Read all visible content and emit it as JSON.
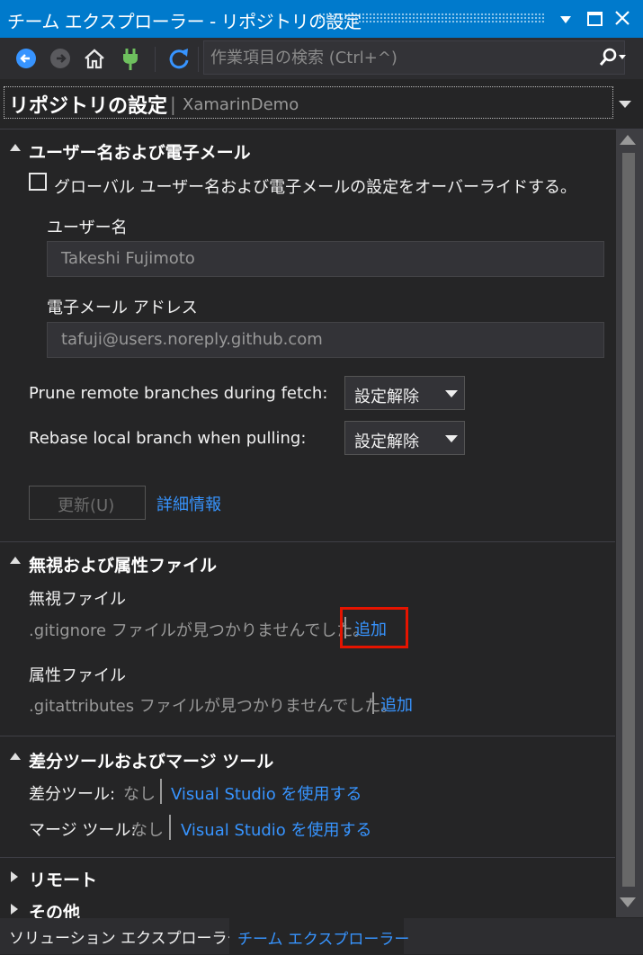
{
  "window": {
    "title": "チーム エクスプローラー - リポジトリの設定",
    "minimize_icon": "dropdown-arrow",
    "maximize_icon": "square",
    "close_icon": "x"
  },
  "toolbar": {
    "search_placeholder": "作業項目の検索 (Ctrl+^)",
    "icons": [
      "back-icon",
      "forward-icon",
      "home-icon",
      "plug-icon",
      "refresh-icon",
      "search-icon"
    ]
  },
  "header": {
    "title": "リポジトリの設定",
    "subtitle": "XamarinDemo"
  },
  "user_section": {
    "title": "ユーザー名および電子メール",
    "override_checkbox_label": "グローバル ユーザー名および電子メールの設定をオーバーライドする。",
    "override_checked": false,
    "username_label": "ユーザー名",
    "username_value": "Takeshi Fujimoto",
    "email_label": "電子メール アドレス",
    "email_value": "tafuji@users.noreply.github.com",
    "prune_label": "Prune remote branches during fetch:",
    "prune_value": "設定解除",
    "rebase_label": "Rebase local branch when pulling:",
    "rebase_value": "設定解除",
    "update_button": "更新(U)",
    "more_info_link": "詳細情報"
  },
  "ignore_section": {
    "title": "無視および属性ファイル",
    "ignore_label": "無視ファイル",
    "ignore_status": ".gitignore ファイルが見つかりませんでした。",
    "ignore_add": "追加",
    "attr_label": "属性ファイル",
    "attr_status": ".gitattributes ファイルが見つかりませんでした。",
    "attr_add": "追加"
  },
  "diff_section": {
    "title": "差分ツールおよびマージ ツール",
    "diff_label": "差分ツール:",
    "diff_value": "なし",
    "diff_link": "Visual Studio を使用する",
    "merge_label": "マージ ツール:",
    "merge_value": "なし",
    "merge_link": "Visual Studio を使用する"
  },
  "collapsed_sections": {
    "remote": "リモート",
    "other": "その他"
  },
  "tabs": [
    {
      "label": "ソリューション エクスプローラー",
      "active": false
    },
    {
      "label": "チーム エクスプローラー",
      "active": true
    }
  ],
  "colors": {
    "accent": "#007acc",
    "link": "#3794ff",
    "highlight": "#e51400",
    "background": "#252526"
  }
}
